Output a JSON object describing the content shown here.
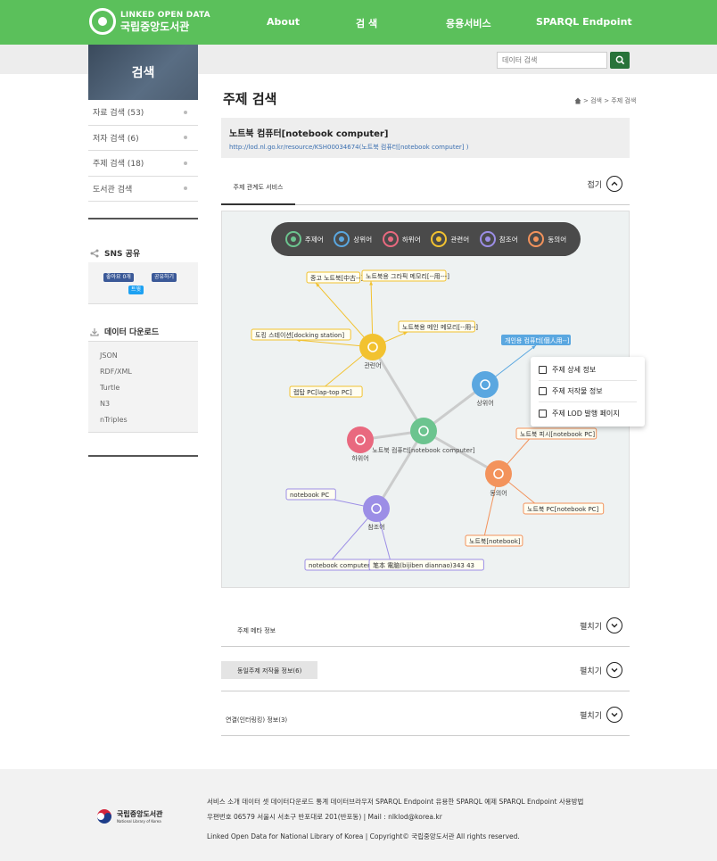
{
  "header": {
    "logo_en": "LINKED OPEN DATA",
    "logo_ko": "국립중앙도서관",
    "nav": [
      "About",
      "검 색",
      "응용서비스",
      "SPARQL Endpoint"
    ],
    "search_placeholder": "데이터 검색"
  },
  "sidebar": {
    "title": "검색",
    "items": [
      {
        "label": "자료 검색 (53)"
      },
      {
        "label": "저자 검색 (6)"
      },
      {
        "label": "주제 검색 (18)"
      },
      {
        "label": "도서관 검색"
      }
    ],
    "sns_title": "SNS 공유",
    "fb_like": "좋아요 0개",
    "fb_share": "공유하기",
    "tweet": "트윗",
    "download_title": "데이터 다운로드",
    "downloads": [
      "JSON",
      "RDF/XML",
      "Turtle",
      "N3",
      "nTriples"
    ]
  },
  "main": {
    "title": "주제 검색",
    "breadcrumb": "> 검색 > 주제 검색",
    "subject_title": "노트북 컴퓨터[notebook computer]",
    "subject_link": "http://lod.nl.go.kr/resource/KSH00034674(노트북 컴퓨터[notebook computer] )",
    "tab_active": "주제 관계도 서비스",
    "collapse_label": "접기",
    "expand_label": "펼치기",
    "sections": [
      {
        "label": "주제 메타 정보"
      },
      {
        "label": "동일주제 저작물 정보(6)"
      },
      {
        "label": "연결(인터링킹) 정보(3)"
      }
    ]
  },
  "graph": {
    "legend": [
      {
        "label": "주제어",
        "icon": "tag-icon",
        "color": "#6cc48f"
      },
      {
        "label": "상위어",
        "icon": "branch-up-icon",
        "color": "#5aa7e0"
      },
      {
        "label": "하위어",
        "icon": "hierarchy-icon",
        "color": "#e9697f"
      },
      {
        "label": "관련어",
        "icon": "related-icon",
        "color": "#f2c230"
      },
      {
        "label": "참조어",
        "icon": "reference-icon",
        "color": "#9c8ee6"
      },
      {
        "label": "동의어",
        "icon": "synonym-icon",
        "color": "#f3935c"
      }
    ],
    "center_label": "노트북 컴퓨터[notebook computer]",
    "node_labels": {
      "related": "관련어",
      "broader": "상위어",
      "narrower": "하위어",
      "reference": "참조어",
      "synonym": "동의어"
    },
    "related_terms": [
      "중고 노트북[中古--]",
      "노트북용 그라픽 메모리[--用---]",
      "도킹 스테이션[docking station]",
      "노트북용 메인 메모리[--用--]",
      "랩탑 PC[lap-top PC]"
    ],
    "broader_terms": [
      "개인용 컴퓨터[個人用--]"
    ],
    "synonym_terms": [
      "노트북 피시[notebook PC]",
      "노트북 PC[notebook PC]",
      "노트북[notebook]"
    ],
    "reference_terms": [
      "notebook PC",
      "notebook computer",
      "笔本 電脑(bijiben diannao)343 43"
    ],
    "popup": [
      "주제 상세 정보",
      "주제 저작물 정보",
      "주제 LOD 발행 페이지"
    ]
  },
  "footer": {
    "logo_ko": "국립중앙도서관",
    "logo_en": "National Library of Korea",
    "links": "서비스 소개  데이터 셋  데이터다운로드  통계  데이터브라우저  SPARQL Endpoint  유용한 SPARQL 예제  SPARQL Endpoint 사용방법",
    "address": "우편번호 06579 서울시 서초구 반포대로 201(반포동) | Mail : nlklod@korea.kr",
    "copyright": "Linked Open Data for National Library of Korea | Copyright© 국립중앙도서관 All rights reserved."
  }
}
